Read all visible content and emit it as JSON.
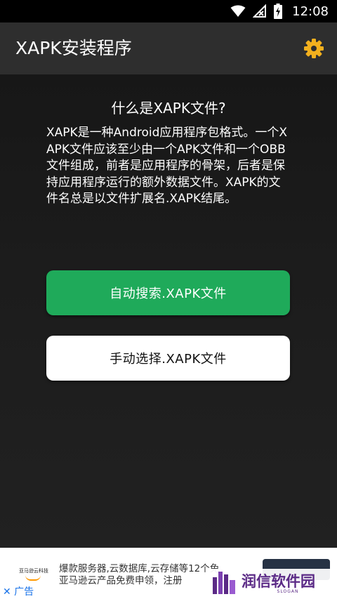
{
  "status_bar": {
    "time": "12:08",
    "icons": [
      "wifi-icon",
      "signal-off-icon",
      "battery-charging-icon"
    ]
  },
  "app_bar": {
    "title": "XAPK安装程序",
    "settings_icon": "gear-icon"
  },
  "content": {
    "heading": "什么是XAPK文件?",
    "description": "XAPK是一种Android应用程序包格式。一个XAPK文件应该至少由一个APK文件和一个OBB文件组成，前者是应用程序的骨架，后者是保持应用程序运行的额外数据文件。XAPK的文件名总是以文件扩展名.XAPK结尾。"
  },
  "buttons": {
    "auto_search": "自动搜索.XAPK文件",
    "manual_select": "手动选择.XAPK文件"
  },
  "ad": {
    "logo_text": "亚马逊云科技",
    "line1": "爆款服务器,云数据库,云存储等12个免",
    "line2": "亚马逊云产品免费申领，注册",
    "close_label": "✕ 广告"
  },
  "watermark": {
    "text": "润信软件园",
    "slogan": "SLOGAN"
  },
  "colors": {
    "accent_green": "#1faa5a",
    "settings_gold": "#f2b01e",
    "app_bar": "#2e2e2e",
    "watermark_purple": "#5b2a86"
  }
}
